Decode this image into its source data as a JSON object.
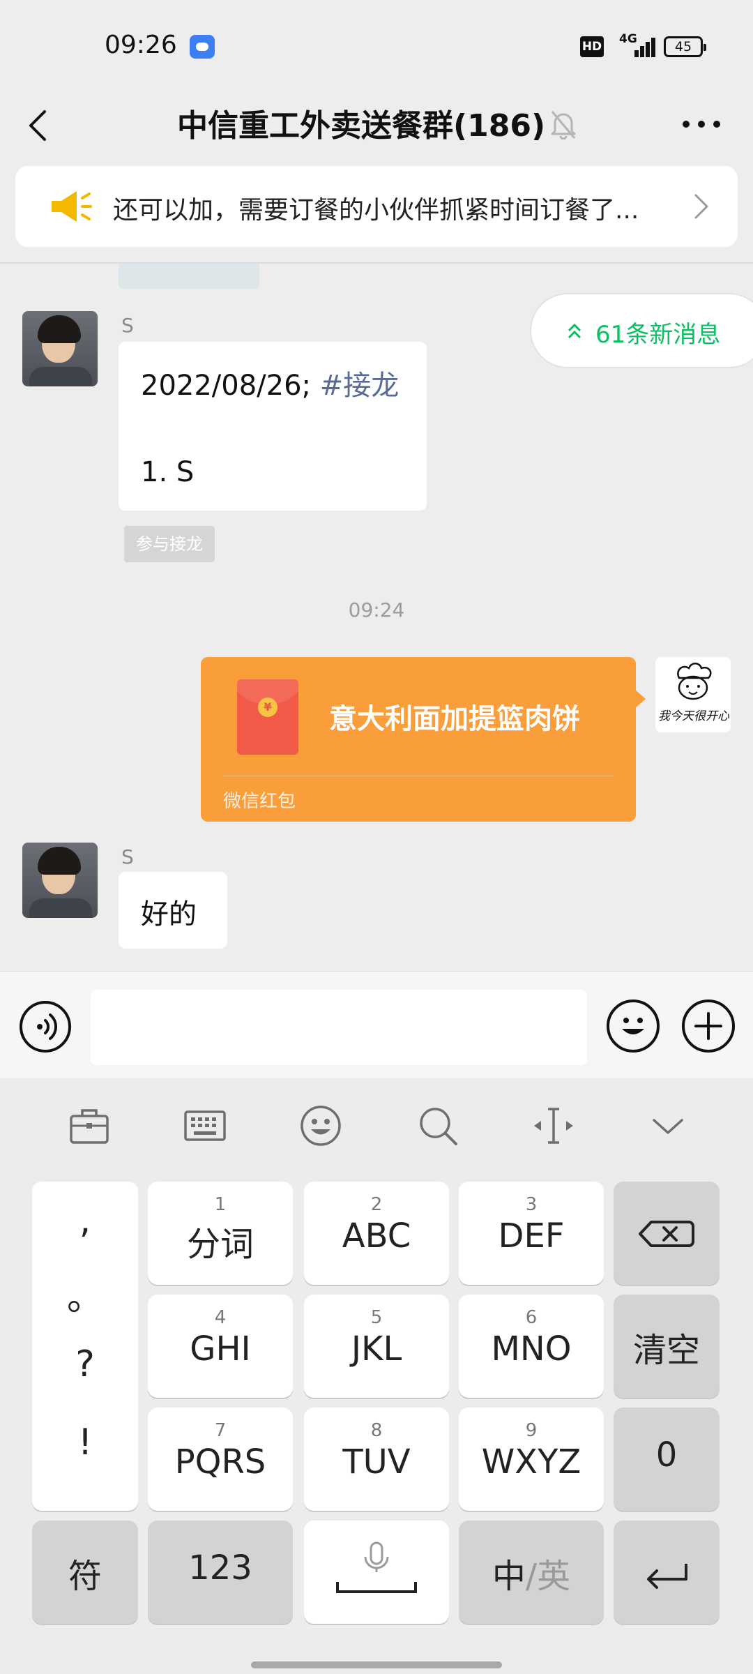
{
  "status_bar": {
    "time": "09:26",
    "hd": "HD",
    "network": "4G",
    "battery": "45"
  },
  "header": {
    "title": "中信重工外卖送餐群(186)"
  },
  "announcement": {
    "text": "还可以加，需要订餐的小伙伴抓紧时间订餐了..."
  },
  "new_messages": {
    "label": "61条新消息"
  },
  "messages": {
    "jielong": {
      "sender": "S",
      "date": "2022/08/26; ",
      "tag": "#接龙",
      "entry": "1. S",
      "join_label": "参与接龙"
    },
    "timestamp": "09:24",
    "red_packet": {
      "title": "意大利面加提篮肉饼",
      "footer": "微信红包",
      "coin": "¥"
    },
    "my_avatar_caption": "我今天很开心",
    "reply": {
      "sender": "S",
      "text": "好的"
    }
  },
  "input": {
    "placeholder": ""
  },
  "keyboard": {
    "punct": [
      ",",
      "。",
      "?",
      "!"
    ],
    "keys": [
      {
        "num": "1",
        "label": "分词"
      },
      {
        "num": "2",
        "label": "ABC"
      },
      {
        "num": "3",
        "label": "DEF"
      },
      {
        "num": "4",
        "label": "GHI"
      },
      {
        "num": "5",
        "label": "JKL"
      },
      {
        "num": "6",
        "label": "MNO"
      },
      {
        "num": "7",
        "label": "PQRS"
      },
      {
        "num": "8",
        "label": "TUV"
      },
      {
        "num": "9",
        "label": "WXYZ"
      }
    ],
    "clear": "清空",
    "zero": "0",
    "symbols": "符",
    "numeric": "123",
    "lang_zh": "中",
    "lang_sep": "/",
    "lang_en": "英"
  },
  "colors": {
    "accent_green": "#07c160",
    "red_packet": "#fa9d3b",
    "link_blue": "#576b95"
  },
  "icons": {
    "back": "chevron-left-icon",
    "mute": "bell-off-icon",
    "more": "more-dots-icon",
    "announce": "megaphone-icon",
    "voice": "voice-icon",
    "emoji": "emoji-icon",
    "plus": "plus-icon",
    "backspace": "backspace-icon",
    "enter": "enter-icon"
  }
}
